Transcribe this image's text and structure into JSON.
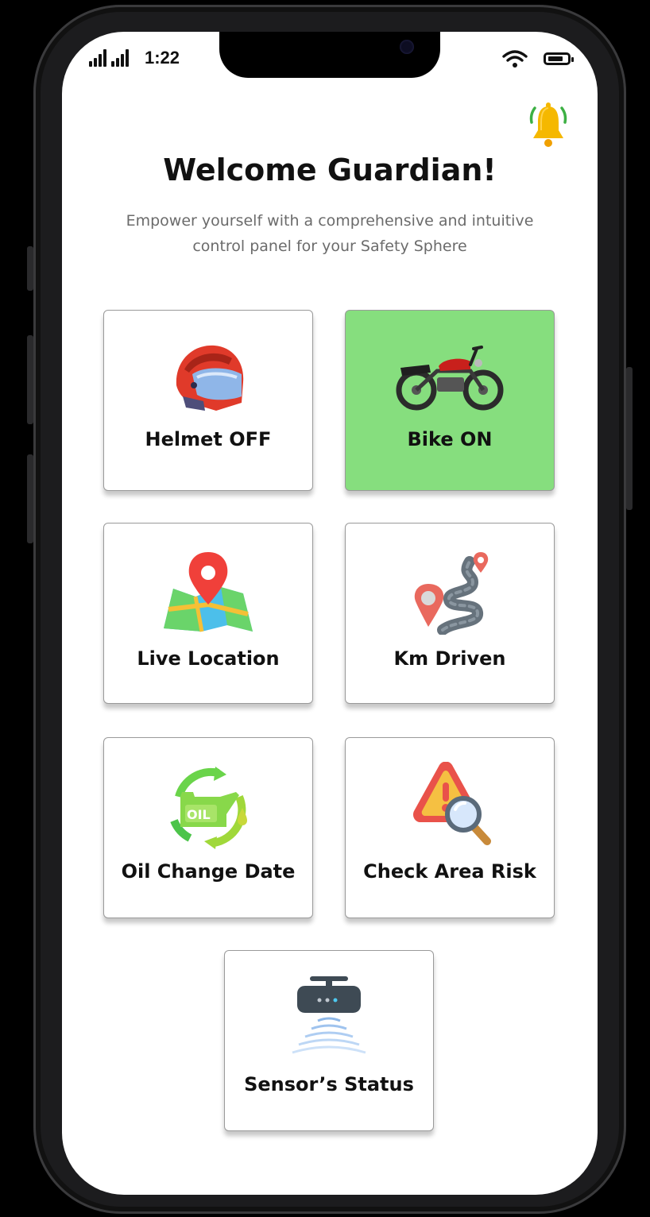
{
  "status_bar": {
    "time": "1:22"
  },
  "header": {
    "title": "Welcome Guardian!",
    "subtitle": "Empower yourself with a comprehensive and intuitive control panel for your Safety Sphere"
  },
  "tiles": [
    {
      "label": "Helmet OFF",
      "icon": "helmet-icon",
      "active": false
    },
    {
      "label": "Bike ON",
      "icon": "motorcycle-icon",
      "active": true
    },
    {
      "label": "Live Location",
      "icon": "map-pin-icon",
      "active": false
    },
    {
      "label": "Km Driven",
      "icon": "route-icon",
      "active": false
    },
    {
      "label": "Oil Change Date",
      "icon": "oil-change-icon",
      "active": false
    },
    {
      "label": "Check Area Risk",
      "icon": "warning-search-icon",
      "active": false
    },
    {
      "label": "Sensor’s Status",
      "icon": "sensor-icon",
      "active": false
    }
  ],
  "colors": {
    "active_tile": "#86de7e",
    "bell": "#f5b800",
    "bell_waves": "#3cb043"
  }
}
